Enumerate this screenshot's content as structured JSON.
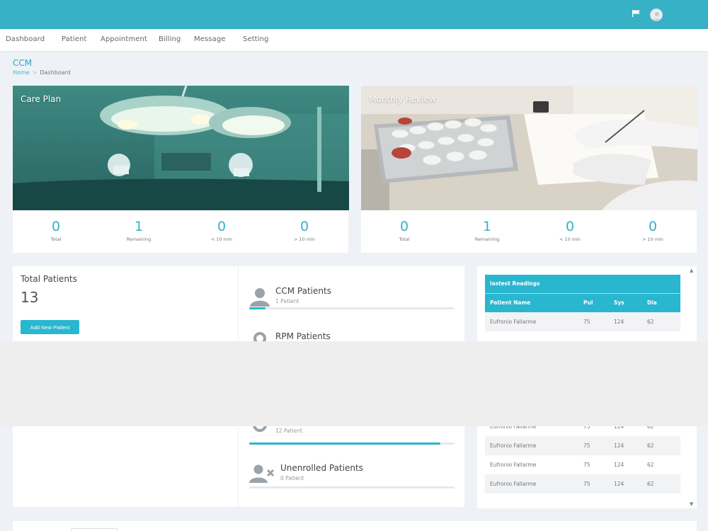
{
  "nav": {
    "items": [
      {
        "label": "Dashboard"
      },
      {
        "label": "Patient"
      },
      {
        "label": "Appointment"
      },
      {
        "label": "Billing"
      },
      {
        "label": "Message"
      },
      {
        "label": "Setting"
      }
    ]
  },
  "header": {
    "flag_icon": "flag-icon",
    "avatar_icon": "user-avatar-icon"
  },
  "page": {
    "title": "CCM",
    "breadcrumb": {
      "home": "Home",
      "separator": ">",
      "current": "Dashboard"
    }
  },
  "care_plan": {
    "title": "Care Plan",
    "stats": [
      {
        "value": "0",
        "label": "Total"
      },
      {
        "value": "1",
        "label": "Remaining"
      },
      {
        "value": "0",
        "label": "< 10 min"
      },
      {
        "value": "0",
        "label": "> 10 min"
      }
    ]
  },
  "monthly_review": {
    "title": "Monthly Review",
    "stats": [
      {
        "value": "0",
        "label": "Total"
      },
      {
        "value": "1",
        "label": "Remaining"
      },
      {
        "value": "0",
        "label": "< 10 min"
      },
      {
        "value": "0",
        "label": "> 10 min"
      }
    ]
  },
  "patients": {
    "total_title": "Total Patients",
    "total_count": "13",
    "add_button": "Add New Patient",
    "groups": [
      {
        "title": "CCM Patients",
        "subtitle": "1 Patient",
        "progress": 0.08,
        "icon": "patient-icon"
      },
      {
        "title": "RPM Patients",
        "subtitle": "",
        "progress": 0,
        "icon": "patient-icon"
      },
      {
        "title": "",
        "subtitle": "12 Patient",
        "progress": 0.93,
        "icon": "patient-icon"
      },
      {
        "title": "Unenrolled Patients",
        "subtitle": "0 Patient",
        "progress": 0,
        "icon": "unenrolled-patient-icon"
      }
    ]
  },
  "readings": {
    "title": "lastest Readings",
    "columns": [
      "Patient Name",
      "Pul",
      "Sys",
      "Dia"
    ],
    "rows": [
      [
        "Eufronio Fallarme",
        "75",
        "124",
        "62"
      ],
      [
        "Eufronio Fallarme",
        "75",
        "124",
        "62"
      ],
      [
        "Eufronio Fallarme",
        "75",
        "124",
        "62"
      ],
      [
        "Eufronio Fallarme",
        "75",
        "124",
        "62"
      ],
      [
        "Eufronio Fallarme",
        "75",
        "124",
        "62"
      ]
    ]
  },
  "colors": {
    "brand": "#36b1c6",
    "accent": "#29b6cf",
    "background": "#eef2f6"
  }
}
